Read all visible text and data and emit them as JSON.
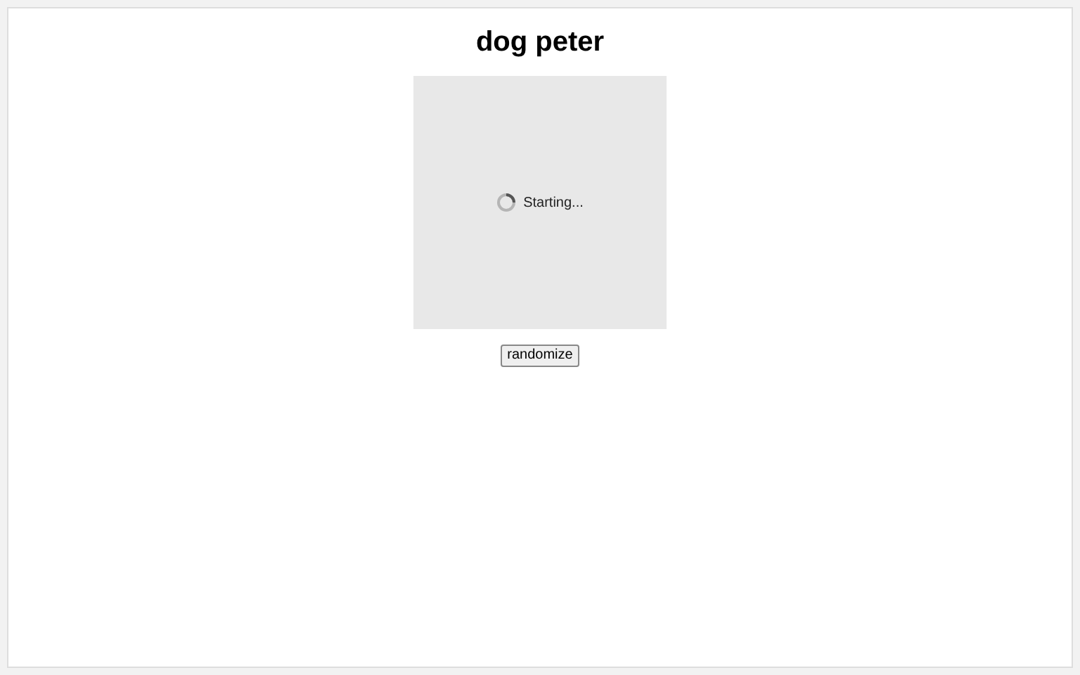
{
  "title": "dog peter",
  "preview": {
    "status": "Starting..."
  },
  "button": "randomize"
}
